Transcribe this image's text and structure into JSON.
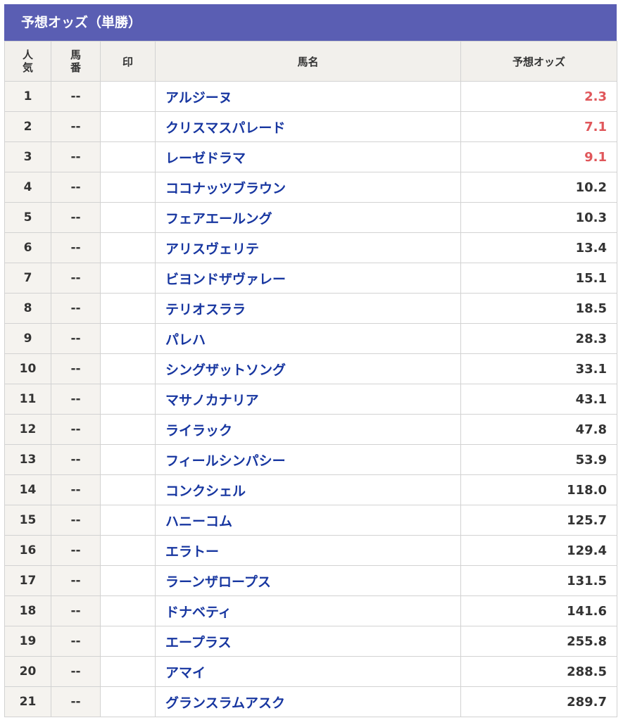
{
  "title": "予想オッズ（単勝）",
  "columns": {
    "rank_line1": "人",
    "rank_line2": "気",
    "num_line1": "馬",
    "num_line2": "番",
    "mark": "印",
    "name": "馬名",
    "odds": "予想オッズ"
  },
  "colors": {
    "header_bar": "#5a5eb3",
    "horse_link": "#1736a0",
    "top_odds": "#e0565a"
  },
  "rows": [
    {
      "rank": "1",
      "num": "--",
      "mark": "",
      "name": "アルジーヌ",
      "odds": "2.3",
      "highlight": true
    },
    {
      "rank": "2",
      "num": "--",
      "mark": "",
      "name": "クリスマスパレード",
      "odds": "7.1",
      "highlight": true
    },
    {
      "rank": "3",
      "num": "--",
      "mark": "",
      "name": "レーゼドラマ",
      "odds": "9.1",
      "highlight": true
    },
    {
      "rank": "4",
      "num": "--",
      "mark": "",
      "name": "ココナッツブラウン",
      "odds": "10.2",
      "highlight": false
    },
    {
      "rank": "5",
      "num": "--",
      "mark": "",
      "name": "フェアエールング",
      "odds": "10.3",
      "highlight": false
    },
    {
      "rank": "6",
      "num": "--",
      "mark": "",
      "name": "アリスヴェリテ",
      "odds": "13.4",
      "highlight": false
    },
    {
      "rank": "7",
      "num": "--",
      "mark": "",
      "name": "ビヨンドザヴァレー",
      "odds": "15.1",
      "highlight": false
    },
    {
      "rank": "8",
      "num": "--",
      "mark": "",
      "name": "テリオスララ",
      "odds": "18.5",
      "highlight": false
    },
    {
      "rank": "9",
      "num": "--",
      "mark": "",
      "name": "パレハ",
      "odds": "28.3",
      "highlight": false
    },
    {
      "rank": "10",
      "num": "--",
      "mark": "",
      "name": "シングザットソング",
      "odds": "33.1",
      "highlight": false
    },
    {
      "rank": "11",
      "num": "--",
      "mark": "",
      "name": "マサノカナリア",
      "odds": "43.1",
      "highlight": false
    },
    {
      "rank": "12",
      "num": "--",
      "mark": "",
      "name": "ライラック",
      "odds": "47.8",
      "highlight": false
    },
    {
      "rank": "13",
      "num": "--",
      "mark": "",
      "name": "フィールシンパシー",
      "odds": "53.9",
      "highlight": false
    },
    {
      "rank": "14",
      "num": "--",
      "mark": "",
      "name": "コンクシェル",
      "odds": "118.0",
      "highlight": false
    },
    {
      "rank": "15",
      "num": "--",
      "mark": "",
      "name": "ハニーコム",
      "odds": "125.7",
      "highlight": false
    },
    {
      "rank": "16",
      "num": "--",
      "mark": "",
      "name": "エラトー",
      "odds": "129.4",
      "highlight": false
    },
    {
      "rank": "17",
      "num": "--",
      "mark": "",
      "name": "ラーンザロープス",
      "odds": "131.5",
      "highlight": false
    },
    {
      "rank": "18",
      "num": "--",
      "mark": "",
      "name": "ドナベティ",
      "odds": "141.6",
      "highlight": false
    },
    {
      "rank": "19",
      "num": "--",
      "mark": "",
      "name": "エープラス",
      "odds": "255.8",
      "highlight": false
    },
    {
      "rank": "20",
      "num": "--",
      "mark": "",
      "name": "アマイ",
      "odds": "288.5",
      "highlight": false
    },
    {
      "rank": "21",
      "num": "--",
      "mark": "",
      "name": "グランスラムアスク",
      "odds": "289.7",
      "highlight": false
    }
  ]
}
